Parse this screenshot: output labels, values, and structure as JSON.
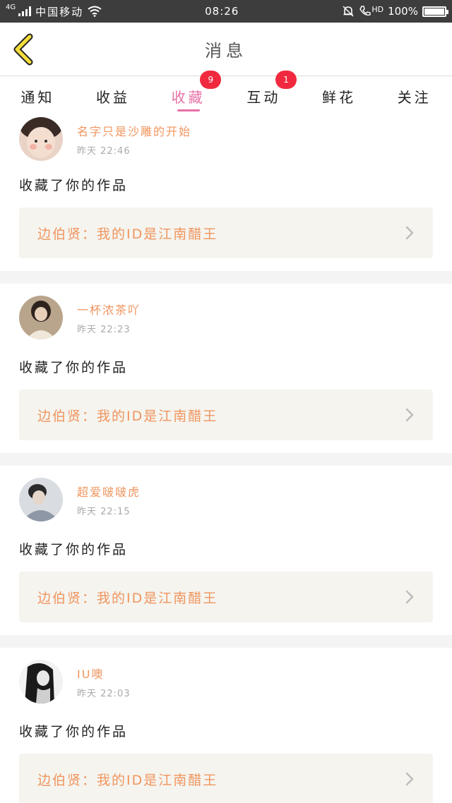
{
  "status_bar": {
    "network": "4G",
    "carrier": "中国移动",
    "time": "08:26",
    "hd": "HD",
    "battery": "100%",
    "icons": [
      "signal-icon",
      "wifi-icon",
      "alarm-icon",
      "hd-call-icon",
      "battery-icon"
    ]
  },
  "header": {
    "title": "消息",
    "back_icon": "back-chevron-icon"
  },
  "tabs": [
    {
      "label": "通知",
      "active": false,
      "badge": ""
    },
    {
      "label": "收益",
      "active": false,
      "badge": ""
    },
    {
      "label": "收藏",
      "active": true,
      "badge": "9"
    },
    {
      "label": "互动",
      "active": false,
      "badge": "1"
    },
    {
      "label": "鲜花",
      "active": false,
      "badge": ""
    },
    {
      "label": "关注",
      "active": false,
      "badge": ""
    }
  ],
  "messages": [
    {
      "name": "名字只是沙雕的开始",
      "time": "昨天 22:46",
      "action": "收藏了你的作品",
      "work": "边伯贤：我的ID是江南醋王"
    },
    {
      "name": "一杯浓茶吖",
      "time": "昨天 22:23",
      "action": "收藏了你的作品",
      "work": "边伯贤：我的ID是江南醋王"
    },
    {
      "name": "超爱啵啵虎",
      "time": "昨天 22:15",
      "action": "收藏了你的作品",
      "work": "边伯贤：我的ID是江南醋王"
    },
    {
      "name": "IU噢",
      "time": "昨天 22:03",
      "action": "收藏了你的作品",
      "work": "边伯贤：我的ID是江南醋王"
    }
  ],
  "colors": {
    "accent": "#e870a6",
    "name": "#f0955e",
    "badge": "#f0293e",
    "back": "#f3dd3c",
    "work_bg": "#f5f4ef"
  }
}
